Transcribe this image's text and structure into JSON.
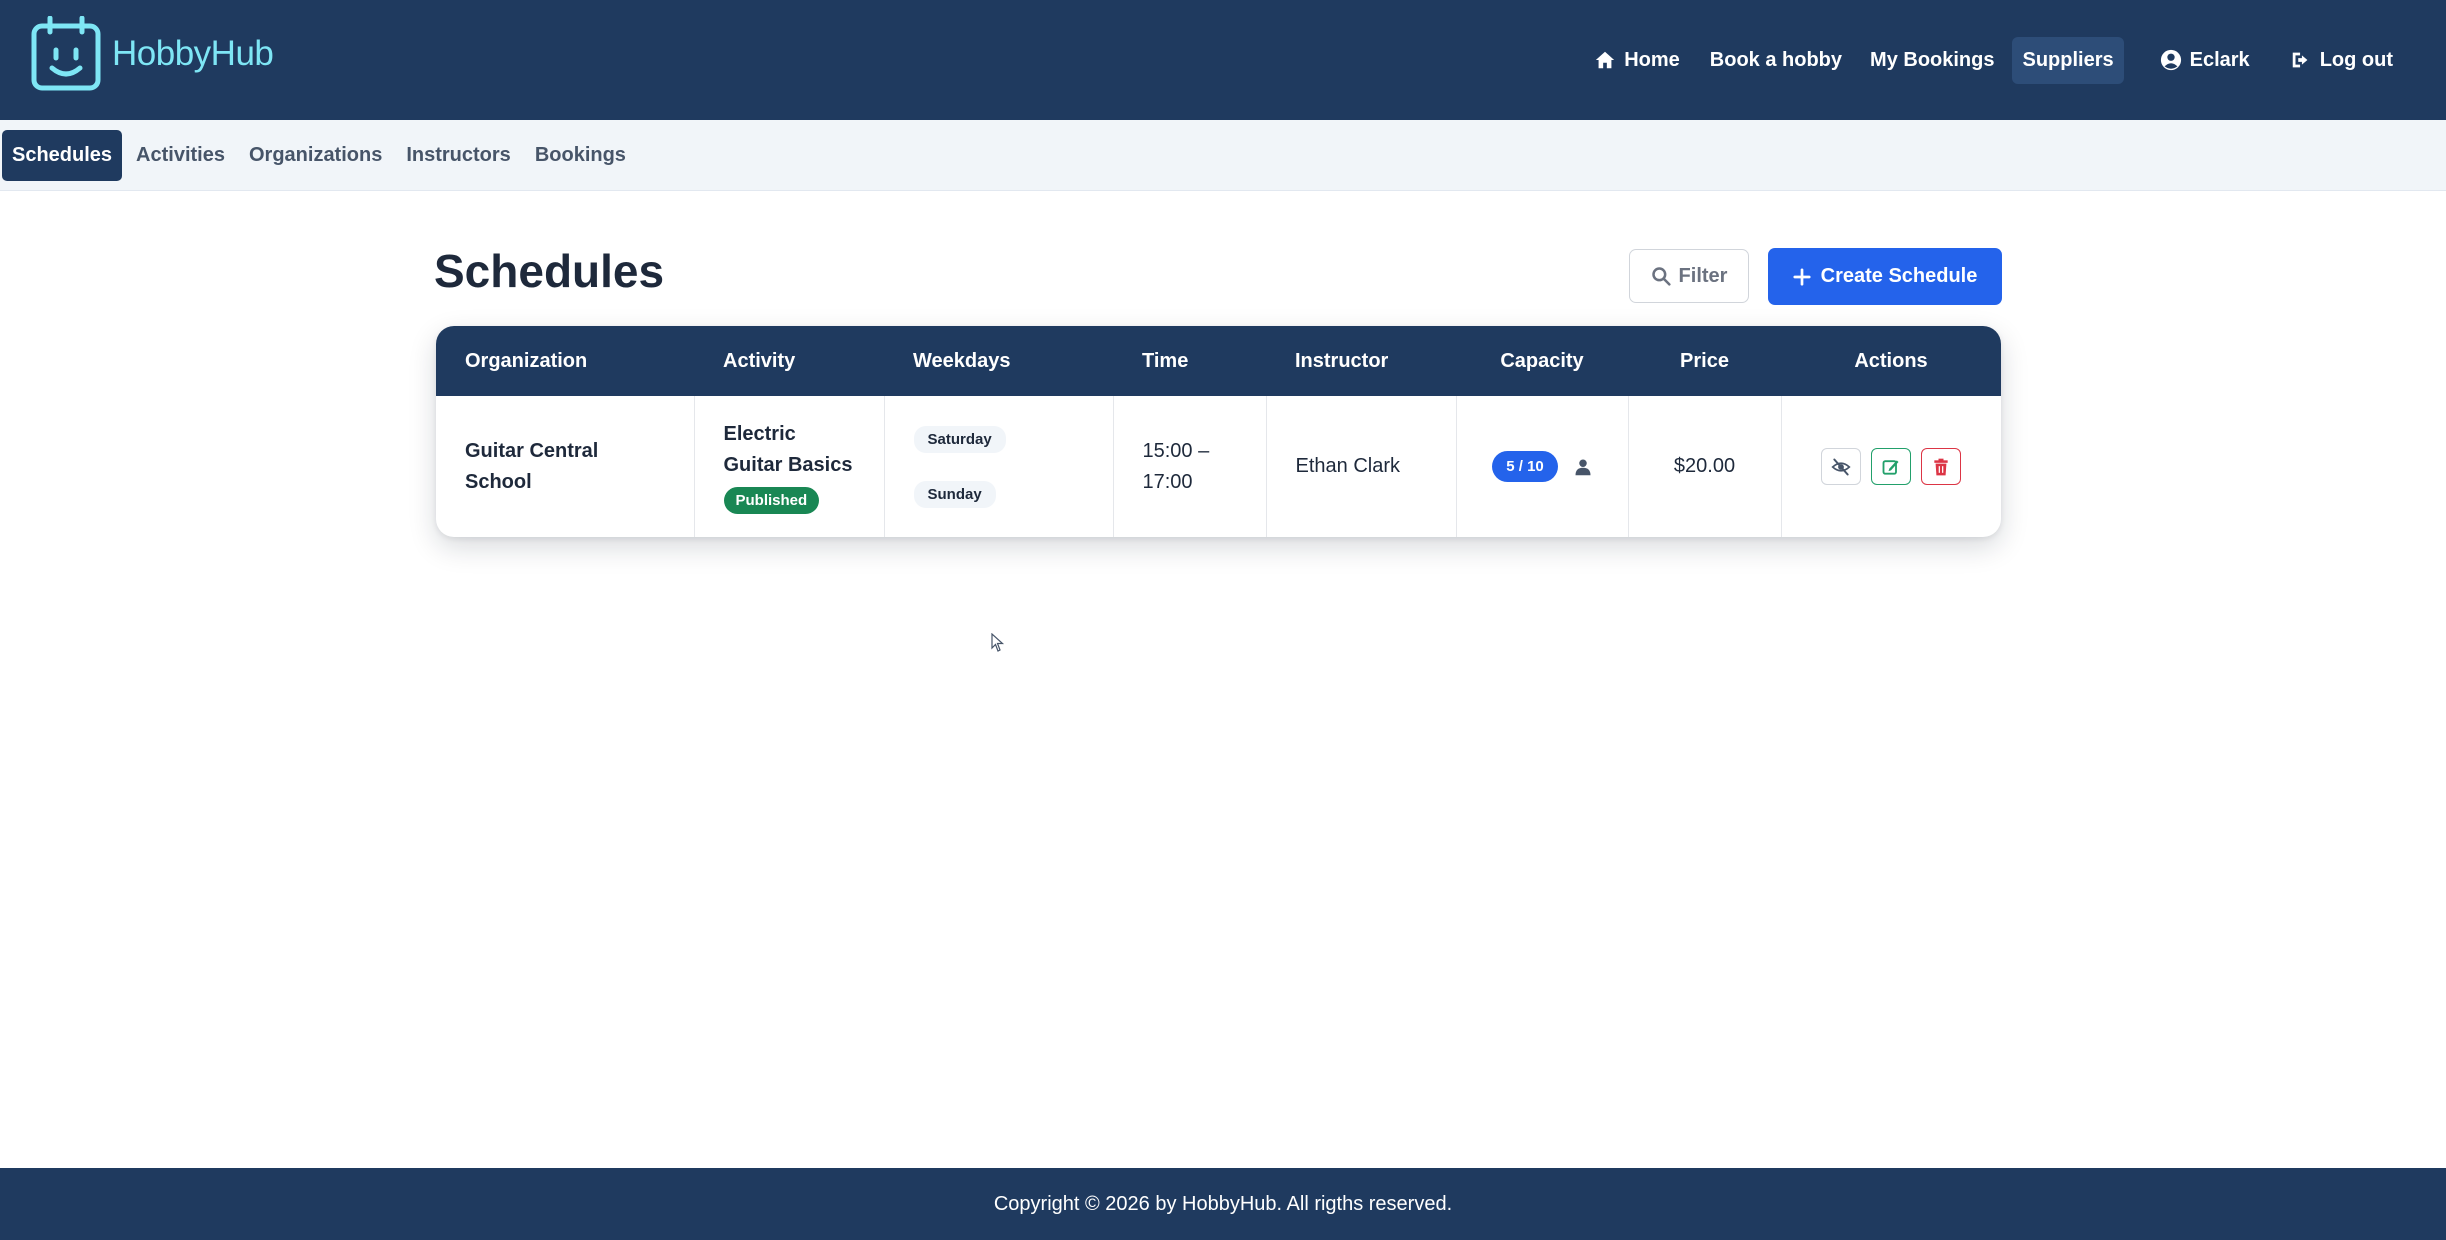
{
  "brand": {
    "name": "HobbyHub",
    "logo_color": "#7ee6f5"
  },
  "nav": {
    "items": [
      {
        "label": "Home",
        "icon": "home-icon"
      },
      {
        "label": "Book a hobby"
      },
      {
        "label": "My Bookings"
      },
      {
        "label": "Suppliers",
        "active": true
      },
      {
        "label": "Eclark",
        "icon": "user-circle-icon"
      },
      {
        "label": "Log out",
        "icon": "logout-icon"
      }
    ]
  },
  "subnav": {
    "items": [
      {
        "label": "Schedules",
        "active": true
      },
      {
        "label": "Activities"
      },
      {
        "label": "Organizations"
      },
      {
        "label": "Instructors"
      },
      {
        "label": "Bookings"
      }
    ]
  },
  "page": {
    "title": "Schedules",
    "filter_label": "Filter",
    "create_label": "Create Schedule"
  },
  "table": {
    "columns": [
      "Organization",
      "Activity",
      "Weekdays",
      "Time",
      "Instructor",
      "Capacity",
      "Price",
      "Actions"
    ],
    "rows": [
      {
        "organization_line1": "Guitar Central",
        "organization_line2": "School",
        "activity_line1": "Electric",
        "activity_line2": "Guitar Basics",
        "status": "Published",
        "weekdays": [
          "Saturday",
          "Sunday"
        ],
        "time_line1": "15:00 –",
        "time_line2": "17:00",
        "instructor": "Ethan Clark",
        "capacity": "5 / 10",
        "price": "$20.00"
      }
    ]
  },
  "footer": {
    "text": "Copyright © 2026 by HobbyHub. All rigths reserved."
  },
  "colors": {
    "navbar": "#1f3a5f",
    "primary": "#2463eb",
    "published": "#198754",
    "edit": "#22a06b",
    "delete": "#dc3545"
  }
}
